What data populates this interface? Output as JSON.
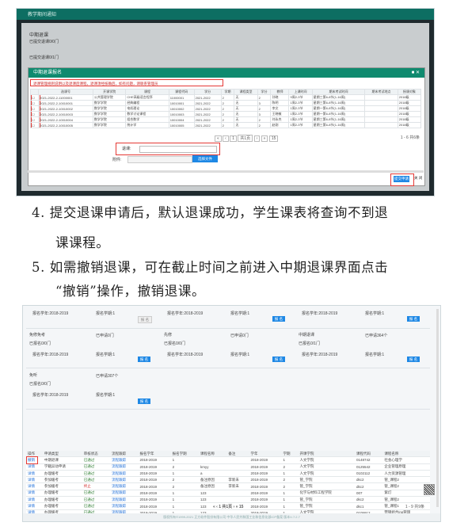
{
  "shot1": {
    "topbar_title": "教学期间通知",
    "bg_labels": [
      "中期退课",
      "已提交退课0/0门",
      "已提交退课0/1门"
    ],
    "modal_title": "中期退课报名",
    "warning": "退课管理规则说明以及退课后课程，退课须经核确后，如有问题，请联系管理员",
    "columns": [
      "",
      "选课号",
      "开课学院",
      "课程",
      "课程代码",
      "学分",
      "学期",
      "课程类型",
      "学分",
      "教师",
      "上课时间",
      "期末考试时间",
      "期末考试地点",
      "授课对象"
    ],
    "rows": [
      [
        "",
        "2021-2022-2-11000001",
        "公共管理学院",
        "CHE高级语言程序",
        "11000001",
        "2021-2022",
        "2",
        "无",
        "2",
        "孙晓",
        "9周2-3节",
        "星期三第6-8节(1-16周)",
        "",
        "2018级"
      ],
      [
        "",
        "2021-2022-2-10010001",
        "数学学院",
        "经典编程",
        "10010001",
        "2021-2022",
        "2",
        "无",
        "3",
        "陈明",
        "1周2-3节",
        "星期三第6-8节(1-16周)",
        "",
        "2018级"
      ],
      [
        "",
        "2021-2022-2-10010002",
        "数学学院",
        "电机理论",
        "10010002",
        "2021-2022",
        "2",
        "无",
        "2",
        "李文",
        "1周2-3节",
        "星期一第6-8节(1-16周)",
        "",
        "2018级"
      ],
      [
        "",
        "2021-2022-2-10010003",
        "数学学院",
        "数学讨论课程",
        "10010003",
        "2021-2022",
        "2",
        "无",
        "3",
        "王晓敏",
        "1周2-3节",
        "星期一第6-8节(1-16周)",
        "",
        "2018级"
      ],
      [
        "",
        "2021-2022-2-10010004",
        "数学学院",
        "组合数学",
        "10010004",
        "2021-2022",
        "2",
        "无",
        "2",
        "刘永杰",
        "1周2-3节",
        "星期三第6-8节(1-16周)",
        "",
        "2018级"
      ],
      [
        "",
        "2021-2022-2-10010005",
        "数学学院",
        "统计学",
        "10010005",
        "2021-2022",
        "2",
        "无",
        "2",
        "赵刚",
        "1周2-3节",
        "星期三第6-8节(1-16周)",
        "",
        "2018级"
      ]
    ],
    "pager": [
      "«",
      "‹",
      "1",
      "共1页",
      "›",
      "»",
      "15"
    ],
    "page_count": "1 - 6 共6条",
    "reason_label": "退课:",
    "file_label": "附件:",
    "file_button": "选择文件",
    "submit": "提交申请",
    "close": "关 闭"
  },
  "para4": "4. 提交退课申请后，默认退课成功，学生课表将查询不到退",
  "para4b": "课课程。",
  "para5": "5. 如需撤销退课，可在截止时间之前进入中期退课界面点击",
  "para5b": "“撤销”操作，撤销退课。",
  "shot2": {
    "cards": [
      {
        "title": "免修免考",
        "count": "已报名0/0门",
        "total": "已申请0门",
        "period": "报名学年:2018-2019",
        "term": "报名学期:1",
        "btn": "报 名"
      },
      {
        "title": "先修",
        "count": "已报名0/0门",
        "total": "已申请0门",
        "period": "报名学年:2018-2019",
        "term": "报名学期:1",
        "btn": "报 名"
      },
      {
        "title": "中期退课",
        "count": "已报名0/1门",
        "total": "已申请364个",
        "period": "报名学年:2018-2019",
        "term": "报名学期:1",
        "btn": "报 名"
      },
      {
        "title": "免听",
        "count": "已报名0/0门",
        "total": "已申请307个",
        "period": "报名学年:2018-2019",
        "term": "报名学期:1",
        "btn": "报 名"
      }
    ],
    "top_row": [
      {
        "period": "报名学年:2018-2019",
        "term": "报名学期:1",
        "btn": "报 名"
      },
      {
        "period": "报名学年:2018-2019",
        "term": "报名学期:1",
        "btn": "报 名"
      },
      {
        "period": "报名学年:2018-2019",
        "term": "报名学期:1",
        "btn": "报 名"
      }
    ],
    "columns": [
      "操作",
      "申请类型",
      "审核状态",
      "流程跟踪",
      "报名学年",
      "报名学期",
      "课程名称",
      "备注",
      "学年",
      "学期",
      "开课学院",
      "课程代码",
      "课程名称"
    ],
    "rows": [
      [
        "撤销",
        "中期退课",
        "已通过",
        "流程跟踪",
        "2018-2019",
        "1",
        "",
        "",
        "2018-2019",
        "1",
        "人文学院",
        "0148742",
        "社会心理学"
      ],
      [
        "详情",
        "学籍异动申请",
        "已通过",
        "流程跟踪",
        "2018-2019",
        "2",
        "kmyy",
        "",
        "2018-2019",
        "2",
        "人文学院",
        "0125542",
        "企业管理原理"
      ],
      [
        "详情",
        "办理缓考",
        "已通过",
        "流程跟踪",
        "2018-2019",
        "1",
        "a",
        "",
        "2018-2019",
        "1",
        "人文学院",
        "0102112",
        "人力资源管理"
      ],
      [
        "详情",
        "参加缓考",
        "已通过",
        "流程跟踪",
        "2018-2019",
        "2",
        "备注原因",
        "李新未",
        "2018-2019",
        "2",
        "管_学院",
        "dkc2",
        "管_课程2"
      ],
      [
        "详情",
        "参加缓考",
        "终止",
        "流程跟踪",
        "2018-2019",
        "2",
        "备注原因",
        "李新未",
        "2018-2019",
        "2",
        "管_学院",
        "dkc2",
        "管_课程2"
      ],
      [
        "详情",
        "办理缓考",
        "已通过",
        "流程跟踪",
        "2018-2019",
        "1",
        "123",
        "",
        "2018-2019",
        "1",
        "化学与材料工程学院",
        "007",
        "紫灯"
      ],
      [
        "详情",
        "办理缓考",
        "已通过",
        "流程跟踪",
        "2018-2019",
        "1",
        "123",
        "",
        "2018-2019",
        "1",
        "管_学院",
        "dkc2",
        "管_课程2"
      ],
      [
        "详情",
        "办理缓考",
        "已通过",
        "流程跟踪",
        "2018-2019",
        "1",
        "123",
        "",
        "2018-2019",
        "1",
        "管_学院",
        "dkc1",
        "管_课程1"
      ],
      [
        "详情",
        "办理缓考",
        "已通过",
        "流程跟踪",
        "2018-2019",
        "1",
        "123",
        "",
        "2018-2019",
        "1",
        "人文学院",
        "0105912",
        "营销组合ing管理"
      ]
    ],
    "pager": [
      "«",
      "‹",
      "1",
      "共1页",
      "›",
      "»",
      "15"
    ],
    "page_count": "1 - 9 共9条",
    "footer": "版权所有©1999-2021 正方软件股份有限公司  中华人民共和国工业和信息化部ICP备案  版本V-7.2.7"
  }
}
